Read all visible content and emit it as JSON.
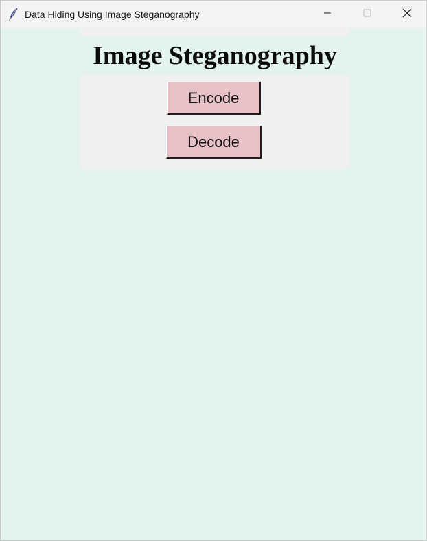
{
  "window": {
    "title": "Data Hiding Using Image Steganography",
    "app_icon": "feather-icon",
    "controls": {
      "minimize_icon": "minimize-icon",
      "maximize_icon": "maximize-icon",
      "close_icon": "close-icon"
    }
  },
  "main": {
    "heading": "Image Steganography",
    "buttons": {
      "encode_label": "Encode",
      "decode_label": "Decode"
    }
  },
  "colors": {
    "background": "#e2f3f0",
    "panel": "#f0f0f0",
    "button": "#e8c1c6",
    "titlebar": "#f3f3f3"
  }
}
